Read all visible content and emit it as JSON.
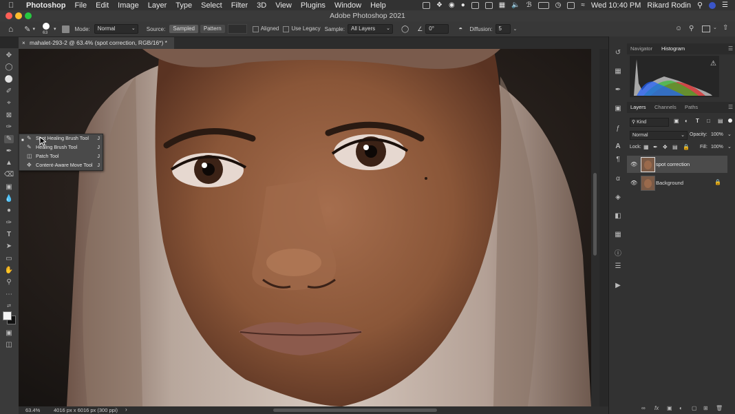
{
  "menubar": {
    "app": "Photoshop",
    "items": [
      "File",
      "Edit",
      "Image",
      "Layer",
      "Type",
      "Select",
      "Filter",
      "3D",
      "View",
      "Plugins",
      "Window",
      "Help"
    ],
    "clock": "Wed 10:40 PM",
    "user": "Rikard Rodin"
  },
  "window": {
    "title": "Adobe Photoshop 2021"
  },
  "options": {
    "brush_size": "63",
    "mode_label": "Mode:",
    "mode_value": "Normal",
    "source_label": "Source:",
    "sampled": "Sampled",
    "pattern": "Pattern",
    "aligned": "Aligned",
    "use_legacy": "Use Legacy",
    "sample_label": "Sample:",
    "sample_value": "All Layers",
    "angle": "0°",
    "diffusion_label": "Diffusion:",
    "diffusion_value": "5"
  },
  "document": {
    "tab": "mahalet-293-2 @ 63.4% (spot correction, RGB/16*) *"
  },
  "status": {
    "zoom": "63.4%",
    "size": "4016 px x 6016 px (300 ppi)"
  },
  "flyout": [
    {
      "label": "Spot Healing Brush Tool",
      "key": "J"
    },
    {
      "label": "Healing Brush Tool",
      "key": "J"
    },
    {
      "label": "Patch Tool",
      "key": "J"
    },
    {
      "label": "Content-Aware Move Tool",
      "key": "J"
    }
  ],
  "panels": {
    "top_tabs": [
      "Navigator",
      "Histogram"
    ],
    "layer_tabs": [
      "Layers",
      "Channels",
      "Paths"
    ],
    "kind": "Kind",
    "blend": "Normal",
    "opacity_label": "Opacity:",
    "opacity": "100%",
    "lock_label": "Lock:",
    "fill_label": "Fill:",
    "fill": "100%",
    "layers": [
      "spot correction",
      "Background"
    ]
  },
  "colors": {
    "accent": "#1473e6",
    "panel": "#323232",
    "selected_layer": "#4b4b4b"
  }
}
